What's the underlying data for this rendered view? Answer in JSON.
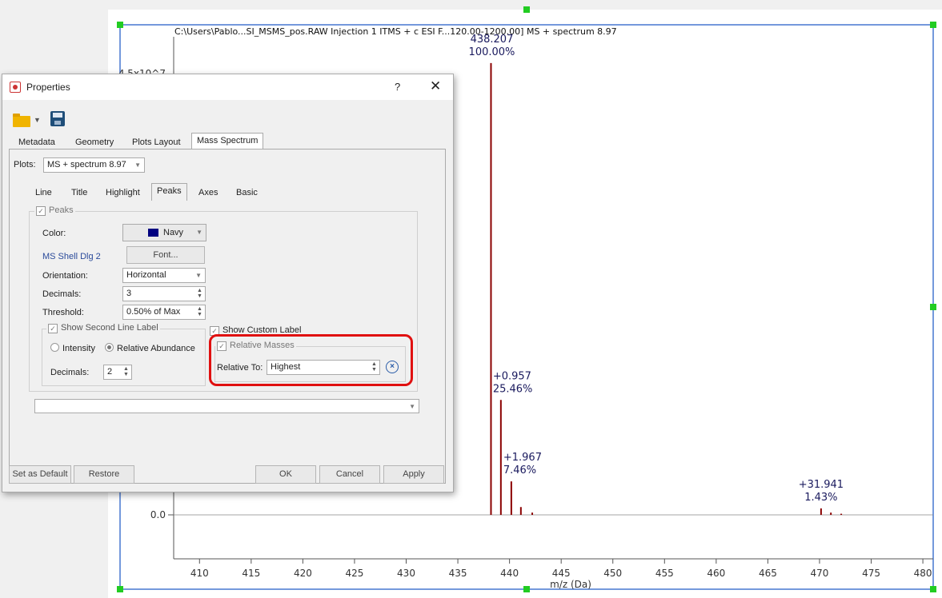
{
  "plot": {
    "title": "C:\\Users\\Pablo...SI_MSMS_pos.RAW Injection 1 ITMS + c ESI F...120.00-1200.00] MS + spectrum 8.97",
    "y_top_label": "4.5x10^7",
    "y_zero_label": "0.0",
    "x_axis_label": "m/z (Da)",
    "x_ticks": [
      "410",
      "415",
      "420",
      "425",
      "430",
      "435",
      "440",
      "445",
      "450",
      "455",
      "460",
      "465",
      "470",
      "475",
      "480"
    ],
    "peak_labels": [
      {
        "line1": "438.207",
        "line2": "100.00%"
      },
      {
        "line1": "+0.957",
        "line2": "25.46%"
      },
      {
        "line1": "+1.967",
        "line2": "7.46%"
      },
      {
        "line1": "+31.941",
        "line2": "1.43%"
      }
    ],
    "colors": {
      "peak": "#8b0000",
      "label": "#1a1a5e",
      "frame": "#2a62c9",
      "handle": "#22cc22"
    }
  },
  "chart_data": {
    "type": "bar",
    "title": "C:\\Users\\Pablo...SI_MSMS_pos.RAW Injection 1 ITMS + c ESI F...120.00-1200.00] MS + spectrum 8.97",
    "xlabel": "m/z (Da)",
    "ylabel": "",
    "xlim": [
      407.5,
      481
    ],
    "ylim": [
      -0.4,
      4.5
    ],
    "x_ticks": [
      410,
      415,
      420,
      425,
      430,
      435,
      440,
      445,
      450,
      455,
      460,
      465,
      470,
      475,
      480
    ],
    "peaks": [
      {
        "x": 438.207,
        "y": 4.05
      },
      {
        "x": 439.164,
        "y": 1.03
      },
      {
        "x": 440.174,
        "y": 0.3
      },
      {
        "x": 441.1,
        "y": 0.07
      },
      {
        "x": 442.2,
        "y": 0.02
      },
      {
        "x": 470.148,
        "y": 0.058
      },
      {
        "x": 471.1,
        "y": 0.02
      },
      {
        "x": 472.1,
        "y": 0.01
      }
    ]
  },
  "dialog": {
    "title": "Properties",
    "help": "?",
    "close": "✕",
    "tabs": [
      "Metadata",
      "Geometry",
      "Plots Layout",
      "Mass Spectrum"
    ],
    "plots_label": "Plots:",
    "plots_value": "MS + spectrum 8.97",
    "subtabs": [
      "Line",
      "Title",
      "Highlight",
      "Peaks",
      "Axes",
      "Basic"
    ],
    "peaks_group": "Peaks",
    "color_label": "Color:",
    "color_value": "Navy",
    "color_swatch": "#000080",
    "font_label": "MS Shell Dlg 2",
    "font_button": "Font...",
    "orientation_label": "Orientation:",
    "orientation_value": "Horizontal",
    "decimals_label": "Decimals:",
    "decimals_value": "3",
    "threshold_label": "Threshold:",
    "threshold_value": "0.50% of Max",
    "second_line_group": "Show Second Line Label",
    "radio_intensity": "Intensity",
    "radio_relative": "Relative Abundance",
    "decimals2_label": "Decimals:",
    "decimals2_value": "2",
    "custom_label": "Show Custom Label",
    "relative_masses_group": "Relative Masses",
    "relative_to_label": "Relative To:",
    "relative_to_value": "Highest",
    "set_default": "Set as Default",
    "restore": "Restore",
    "ok": "OK",
    "cancel": "Cancel",
    "apply": "Apply"
  }
}
